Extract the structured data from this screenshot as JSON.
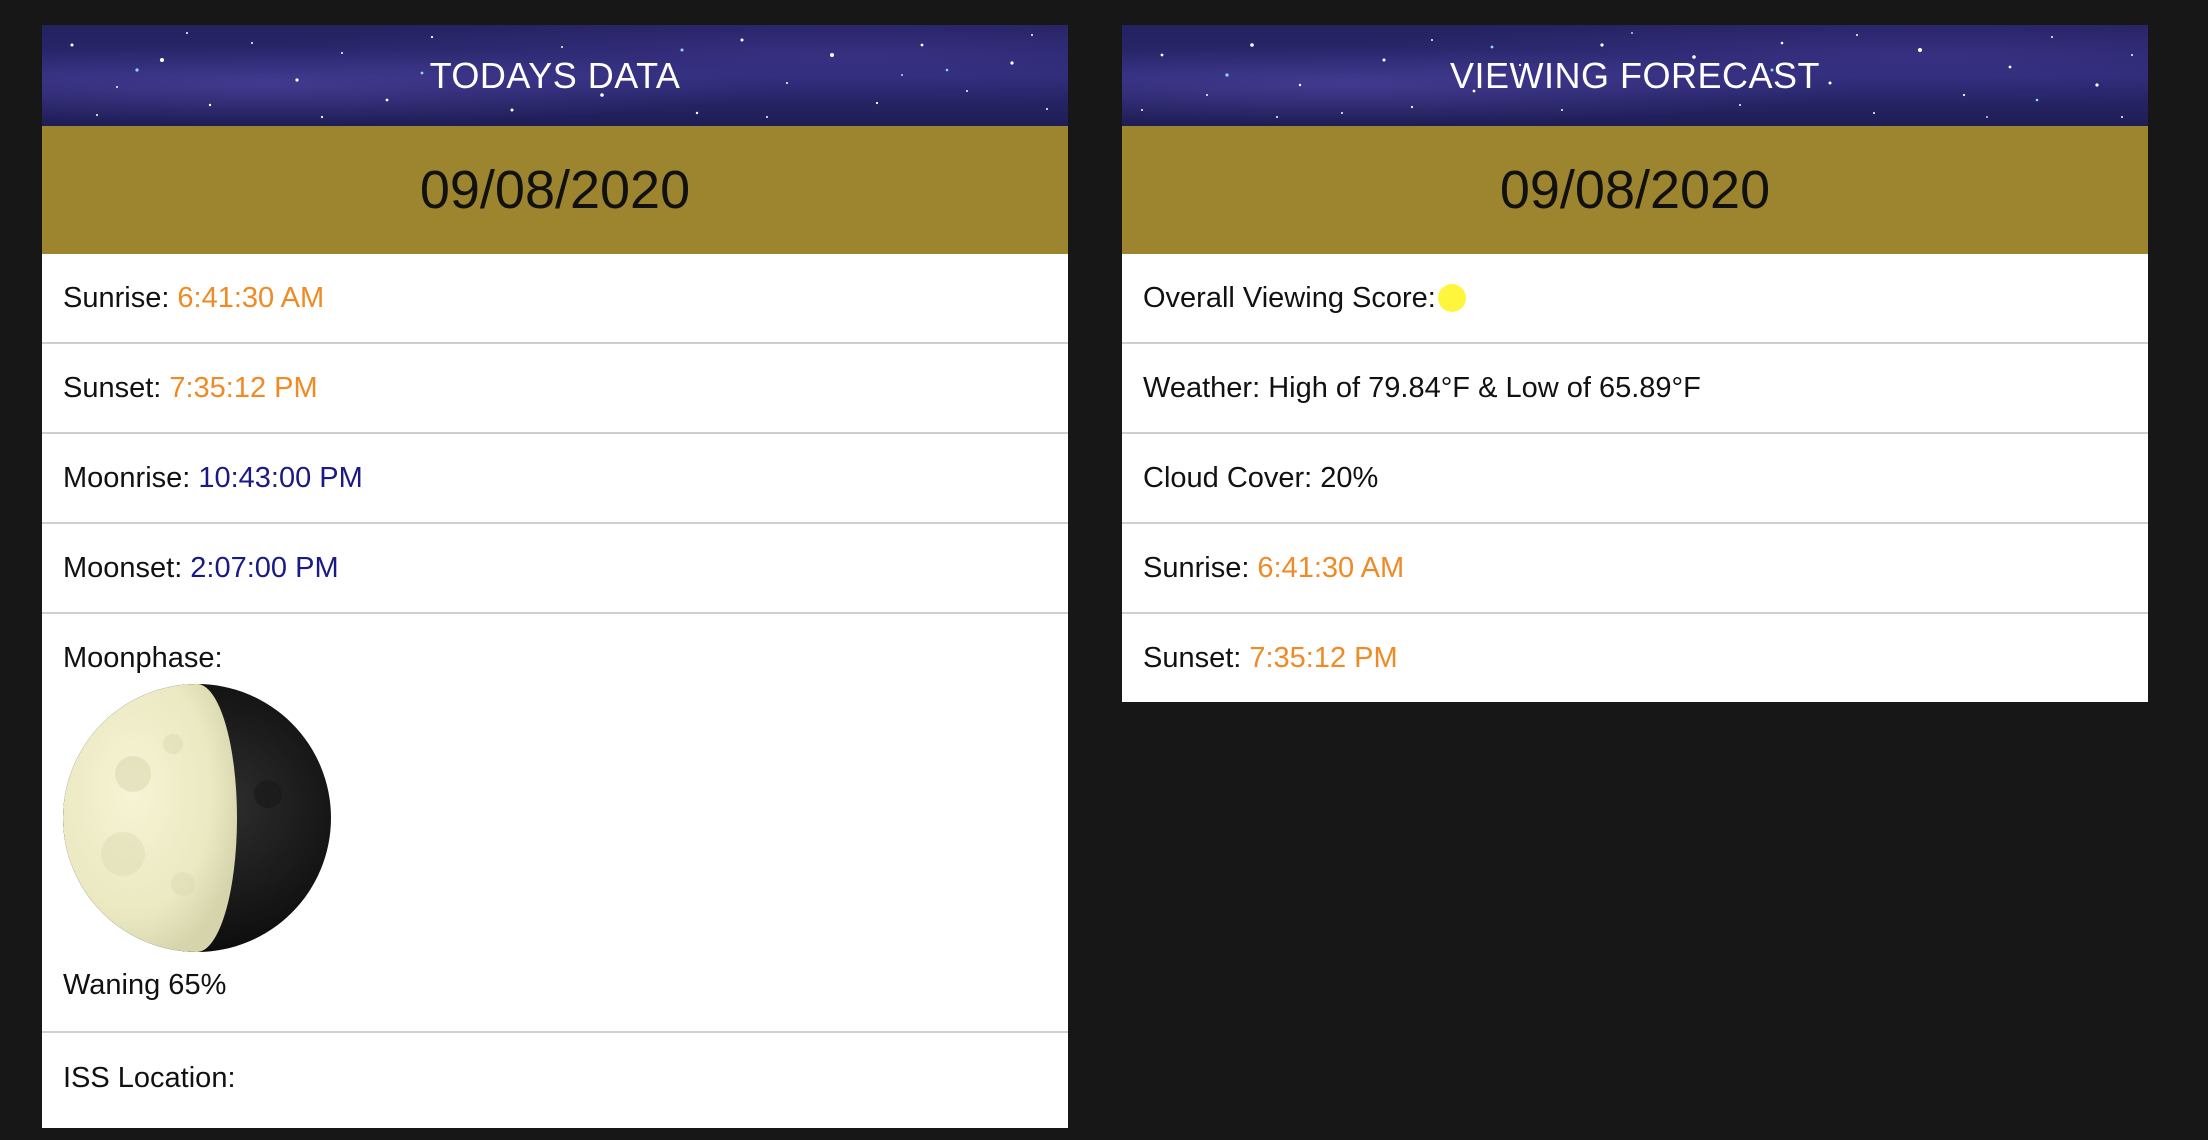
{
  "todays": {
    "title": "TODAYS DATA",
    "date": "09/08/2020",
    "sunrise_label": "Sunrise:",
    "sunrise_value": "6:41:30 AM",
    "sunset_label": "Sunset:",
    "sunset_value": "7:35:12 PM",
    "moonrise_label": "Moonrise:",
    "moonrise_value": "10:43:00 PM",
    "moonset_label": "Moonset:",
    "moonset_value": "2:07:00 PM",
    "moonphase_label": "Moonphase:",
    "moonphase_caption": "Waning 65%",
    "moon_illumination": 0.65,
    "iss_label": "ISS Location:"
  },
  "forecast": {
    "title": "VIEWING FORECAST",
    "date": "09/08/2020",
    "score_label": "Overall Viewing Score:",
    "score_color": "#fef53d",
    "weather_text": "Weather: High of 79.84°F & Low of 65.89°F",
    "cloud_text": "Cloud Cover: 20%",
    "sunrise_label": "Sunrise:",
    "sunrise_value": "6:41:30 AM",
    "sunset_label": "Sunset:",
    "sunset_value": "7:35:12 PM"
  },
  "colors": {
    "background": "#171717",
    "date_band": "#9c852e",
    "sun_time": "#f08a24",
    "moon_time": "#1a1a84"
  }
}
